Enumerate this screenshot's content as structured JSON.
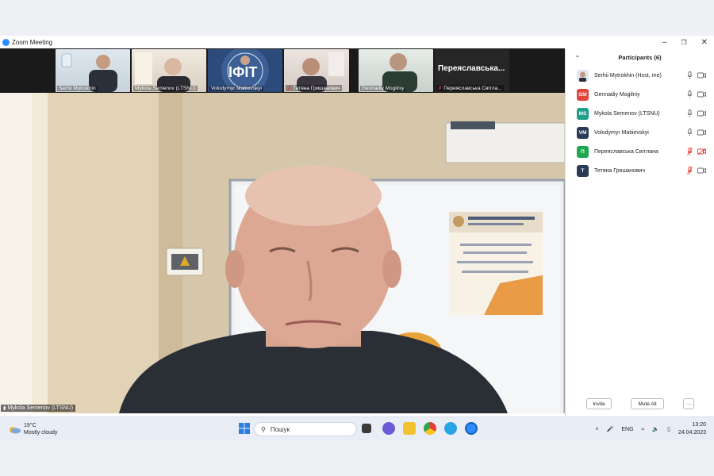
{
  "window": {
    "title": "Zoom Meeting",
    "controls": [
      "minimize",
      "restore",
      "close"
    ]
  },
  "gallery": [
    {
      "name": "Serhii Mytrokhin",
      "muted": false
    },
    {
      "name": "Mykola Semenov (LTSNU)",
      "muted": false
    },
    {
      "name": "Volodymyr Matiievskyi",
      "muted": false
    },
    {
      "name": "Тетяна Гришанович",
      "muted": true
    },
    {
      "name": "Gennadiy Mogilniy",
      "muted": false
    },
    {
      "name": "Переяславська Світла...",
      "muted": true,
      "big_label": "Переяславська..."
    }
  ],
  "speaker": {
    "name": "Mykola Semenov (LTSNU)"
  },
  "participants": {
    "title": "Participants (6)",
    "items": [
      {
        "name": "Serhii Mytrokhin (Host, me)",
        "initials": "",
        "color": "#dfe6ef",
        "mic_muted": false,
        "video_off": false,
        "photo": true
      },
      {
        "name": "Gennadiy Mogilniy",
        "initials": "GM",
        "color": "#e2453c",
        "mic_muted": false,
        "video_off": false
      },
      {
        "name": "Mykola Semenov (LTSNU)",
        "initials": "MS",
        "color": "#1f9e8a",
        "mic_muted": false,
        "video_off": false
      },
      {
        "name": "Volodymyr Matiievskyi",
        "initials": "VM",
        "color": "#2b3a55",
        "mic_muted": false,
        "video_off": false
      },
      {
        "name": "Переяславська Світлана",
        "initials": "П",
        "color": "#1fa84f",
        "mic_muted": true,
        "video_off": true
      },
      {
        "name": "Тетяна Гришанович",
        "initials": "Т",
        "color": "#2b3a55",
        "mic_muted": true,
        "video_off": false
      }
    ],
    "invite_label": "Invite",
    "mute_all_label": "Mute All",
    "more_label": "···"
  },
  "taskbar": {
    "weather_temp": "19°C",
    "weather_desc": "Mostly cloudy",
    "search_placeholder": "Пошук",
    "lang": "ENG",
    "time": "13:20",
    "date": "24.04.2023"
  },
  "colors": {
    "zoom_blue": "#2d8cff",
    "muted_red": "#e03c31"
  }
}
